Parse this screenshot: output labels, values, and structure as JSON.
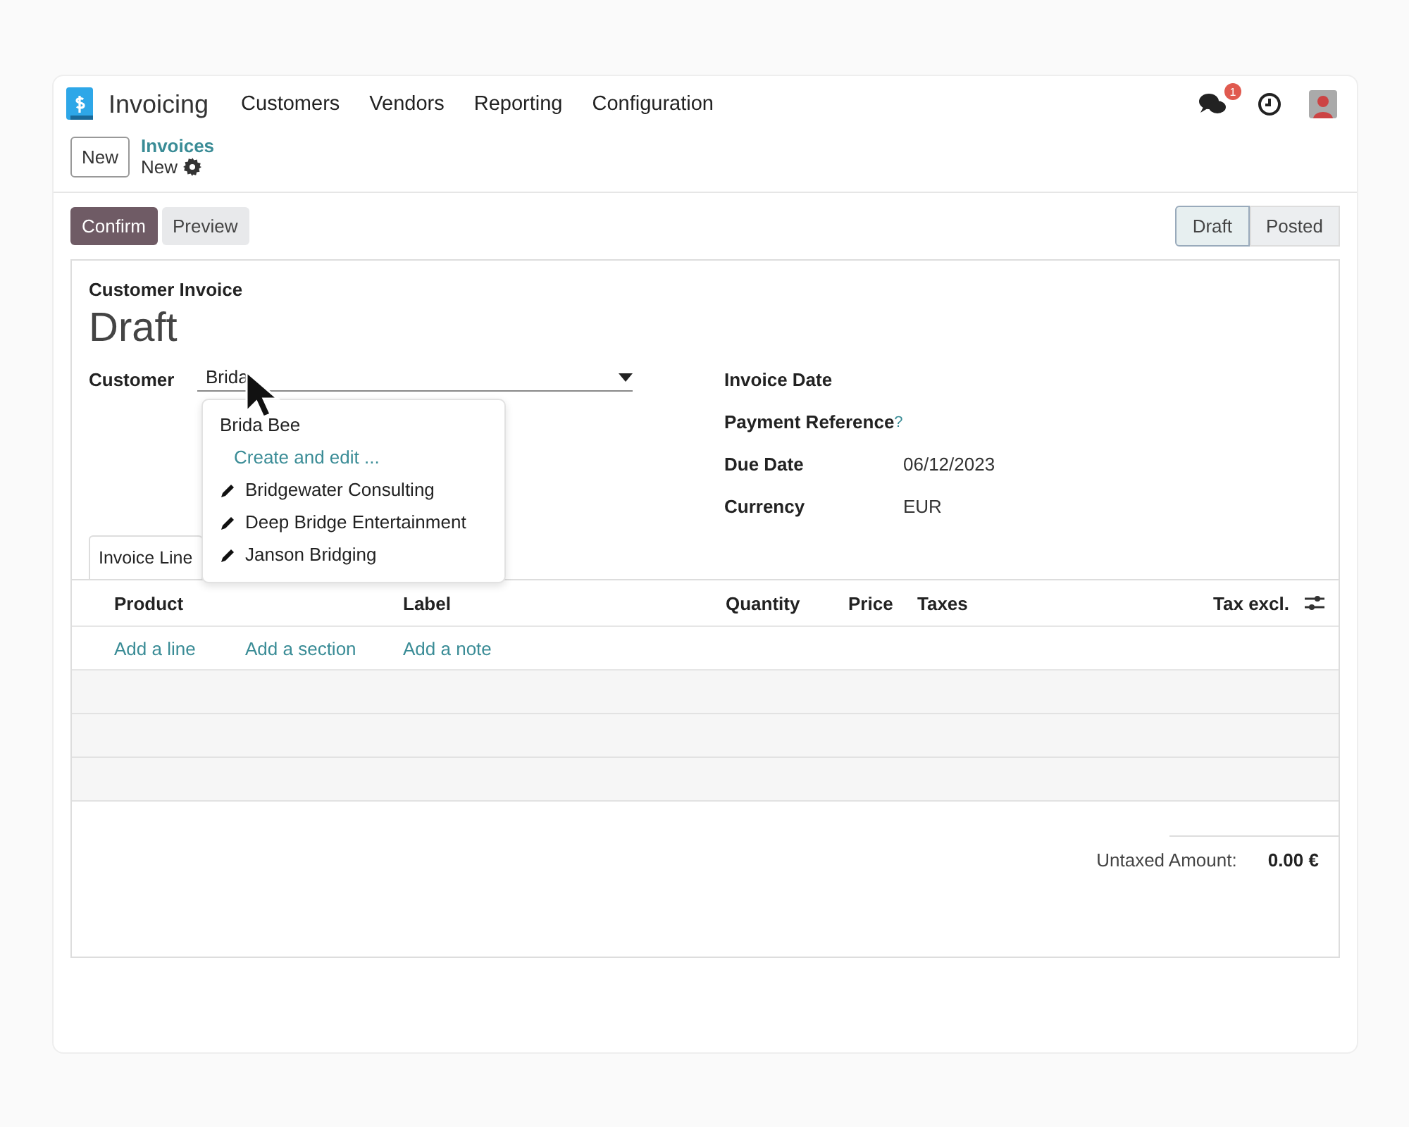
{
  "app": {
    "name": "Invoicing",
    "menu": [
      "Customers",
      "Vendors",
      "Reporting",
      "Configuration"
    ],
    "notification_count": "1"
  },
  "breadcrumb": {
    "new_button": "New",
    "parent": "Invoices",
    "current": "New"
  },
  "actions": [
    {
      "label": "Confirm",
      "kind": "primary"
    },
    {
      "label": "Preview",
      "kind": "secondary"
    }
  ],
  "status_steps": [
    {
      "label": "Draft",
      "selected": true
    },
    {
      "label": "Posted",
      "selected": false
    }
  ],
  "form": {
    "type_label": "Customer Invoice",
    "title": "Draft",
    "customer": {
      "label": "Customer",
      "value": "Brida"
    },
    "autocomplete": [
      {
        "label": "Brida Bee",
        "kind": "plain"
      },
      {
        "label": "Create and edit ...",
        "kind": "link"
      },
      {
        "label": "Bridgewater Consulting",
        "kind": "record"
      },
      {
        "label": "Deep Bridge Entertainment",
        "kind": "record"
      },
      {
        "label": "Janson Bridging",
        "kind": "record"
      }
    ],
    "fields": [
      {
        "label": "Invoice Date"
      },
      {
        "label": "Payment Reference",
        "help_mark": "?"
      },
      {
        "label": "Due Date",
        "value": "06/12/2023"
      },
      {
        "label": "Currency",
        "value": "EUR"
      }
    ],
    "tabs": [
      {
        "label": "Invoice Line",
        "selected": true
      }
    ],
    "table": {
      "columns": [
        "Product",
        "Label",
        "Quantity",
        "Price",
        "Taxes",
        "Tax excl."
      ],
      "add_links": [
        "Add a line",
        "Add a section",
        "Add a note"
      ]
    },
    "totals": {
      "label": "Untaxed Amount:",
      "value": "0.00 €"
    }
  }
}
